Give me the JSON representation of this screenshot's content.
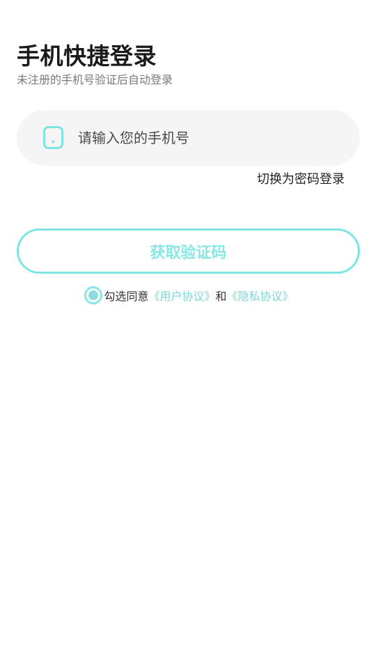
{
  "header": {
    "title": "手机快捷登录",
    "subtitle": "未注册的手机号验证后自动登录"
  },
  "phone": {
    "icon": "phone-icon",
    "placeholder": "请输入您的手机号",
    "value": ""
  },
  "switch_login": {
    "label": "切换为密码登录"
  },
  "get_code": {
    "label": "获取验证码"
  },
  "agreement": {
    "prefix": "勾选同意",
    "user_agreement": "《用户协议》",
    "conjunction": "和",
    "privacy_agreement": "《隐私协议》",
    "checked": true
  },
  "colors": {
    "accent": "#7de6e3",
    "field_bg": "#f5f5f5",
    "title": "#1a1a1a",
    "subtitle": "#7a7a7a"
  }
}
